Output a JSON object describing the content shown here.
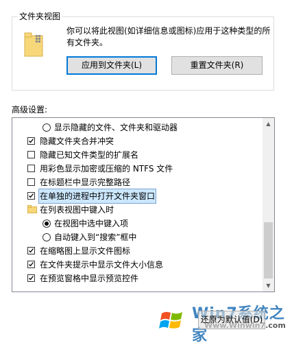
{
  "folder_views": {
    "group_title": "文件夹视图",
    "description": "你可以将此视图(如详细信息或图标)应用于这种类型的所有文件夹。",
    "apply_button": "应用到文件夹(L)",
    "reset_button": "重置文件夹(R)"
  },
  "advanced": {
    "label": "高级设置:",
    "items": [
      {
        "type": "radio",
        "checked": false,
        "label": "显示隐藏的文件、文件夹和驱动器"
      },
      {
        "type": "checkbox",
        "checked": true,
        "label": "隐藏文件夹合并冲突"
      },
      {
        "type": "checkbox",
        "checked": false,
        "label": "隐藏已知文件类型的扩展名"
      },
      {
        "type": "checkbox",
        "checked": false,
        "label": "用彩色显示加密或压缩的 NTFS 文件"
      },
      {
        "type": "checkbox",
        "checked": false,
        "label": "在标题栏中显示完整路径"
      },
      {
        "type": "checkbox",
        "checked": true,
        "label": "在单独的进程中打开文件夹窗口",
        "selected": true
      },
      {
        "type": "folder",
        "label": "在列表视图中键入时"
      },
      {
        "type": "radio",
        "checked": true,
        "label": "在视图中选中键入项"
      },
      {
        "type": "radio",
        "checked": false,
        "label": "自动键入到“搜索”框中"
      },
      {
        "type": "checkbox",
        "checked": true,
        "label": "在缩略图上显示文件图标"
      },
      {
        "type": "checkbox",
        "checked": true,
        "label": "在文件夹提示中显示文件大小信息"
      },
      {
        "type": "checkbox",
        "checked": true,
        "label": "在预览窗格中显示预览控件"
      }
    ]
  },
  "restore_button": "还原为默认值(D)",
  "watermark": {
    "text": "Win7系统之家",
    "url": "Www.Winwin7.com"
  },
  "colors": {
    "selection_bg": "#cce8ff",
    "focus_border": "#0078d7",
    "button_bg": "#e1e1e1"
  }
}
